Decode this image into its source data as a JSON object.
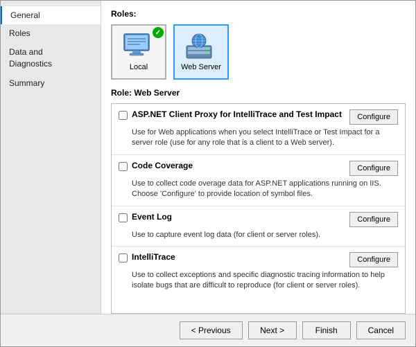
{
  "sidebar": {
    "items": [
      {
        "id": "general",
        "label": "General",
        "active": true
      },
      {
        "id": "roles",
        "label": "Roles",
        "active": false
      },
      {
        "id": "data-diagnostics",
        "label": "Data and\nDiagnostics",
        "active": false
      },
      {
        "id": "summary",
        "label": "Summary",
        "active": false
      }
    ]
  },
  "main": {
    "roles_label": "Roles:",
    "roles": [
      {
        "id": "local",
        "label": "Local",
        "selected": false
      },
      {
        "id": "web-server",
        "label": "Web Server",
        "selected": true
      }
    ],
    "role_subtitle_prefix": "Role:",
    "role_subtitle_value": "Web Server",
    "options": [
      {
        "id": "aspnet-client-proxy",
        "title": "ASP.NET Client Proxy for IntelliTrace and Test Impact",
        "description": "Use for Web applications when you select IntelliTrace or Test Impact for a server role (use for any role that is a client to a Web server).",
        "checked": false,
        "configure_label": "Configure"
      },
      {
        "id": "code-coverage",
        "title": "Code Coverage",
        "description": "Use to collect code overage data for ASP.NET applications running on IIS. Choose 'Configure' to provide location of symbol files.",
        "checked": false,
        "configure_label": "Configure"
      },
      {
        "id": "event-log",
        "title": "Event Log",
        "description": "Use to capture event log data (for client or server roles).",
        "checked": false,
        "configure_label": "Configure"
      },
      {
        "id": "intellitrace",
        "title": "IntelliTrace",
        "description": "Use to collect exceptions and specific diagnostic tracing information to help isolate bugs that are difficult to reproduce (for client or server roles).",
        "checked": false,
        "configure_label": "Configure"
      }
    ]
  },
  "footer": {
    "previous_label": "< Previous",
    "next_label": "Next >",
    "finish_label": "Finish",
    "cancel_label": "Cancel"
  }
}
